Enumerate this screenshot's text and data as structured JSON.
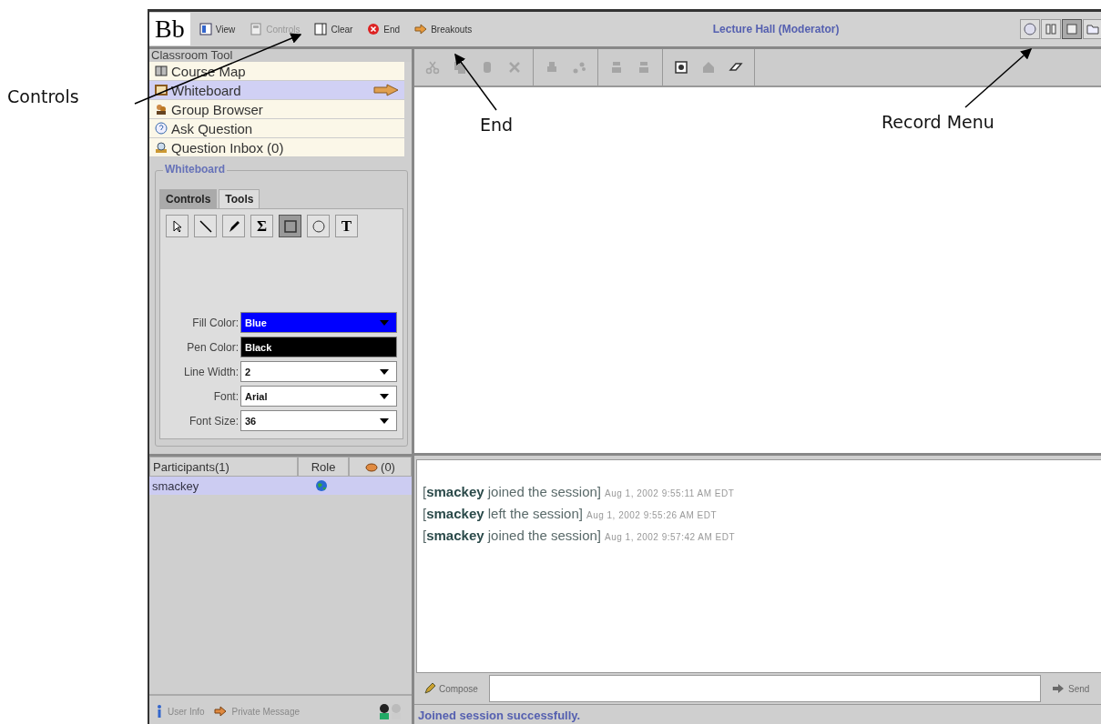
{
  "callouts": [
    {
      "text": "Controls"
    },
    {
      "text": "End"
    },
    {
      "text": "Record Menu"
    }
  ],
  "toolbar": {
    "logo": "Bb",
    "buttons": [
      {
        "label": "View",
        "kind": "view",
        "disabled": false
      },
      {
        "label": "Controls",
        "kind": "controls",
        "disabled": true
      },
      {
        "label": "Clear",
        "kind": "clear",
        "disabled": false
      },
      {
        "label": "End",
        "kind": "end",
        "disabled": false
      },
      {
        "label": "Breakouts",
        "kind": "breakouts",
        "disabled": false
      }
    ],
    "title": "Lecture Hall (Moderator)",
    "record_buttons": [
      {
        "kind": "record",
        "selected": false
      },
      {
        "kind": "pause",
        "selected": false
      },
      {
        "kind": "stop",
        "selected": true
      },
      {
        "kind": "folder",
        "selected": false
      }
    ]
  },
  "classroom": {
    "title": "Classroom Tool",
    "items": [
      {
        "label": "Course Map",
        "kind": "map",
        "selected": false
      },
      {
        "label": "Whiteboard",
        "kind": "whiteboard",
        "selected": true
      },
      {
        "label": "Group Browser",
        "kind": "group",
        "selected": false
      },
      {
        "label": "Ask Question",
        "kind": "question",
        "selected": false
      },
      {
        "label": "Question Inbox (0)",
        "kind": "inbox",
        "selected": false
      }
    ]
  },
  "whiteboard_panel": {
    "title": "Whiteboard",
    "tabs": [
      {
        "label": "Controls",
        "selected": false
      },
      {
        "label": "Tools",
        "selected": true
      }
    ],
    "tools": [
      {
        "kind": "pointer",
        "selected": false
      },
      {
        "kind": "line",
        "selected": false
      },
      {
        "kind": "pen",
        "selected": false
      },
      {
        "kind": "glyph",
        "label": "Σ",
        "selected": false
      },
      {
        "kind": "rectangle",
        "selected": true
      },
      {
        "kind": "ellipse",
        "selected": false
      },
      {
        "kind": "glyph",
        "label": "T",
        "selected": false
      }
    ],
    "fields": [
      {
        "label": "Fill Color:",
        "value": "Blue",
        "kind": "dropdown",
        "color": "#0000ff"
      },
      {
        "label": "Pen Color:",
        "value": "Black",
        "kind": "swatch",
        "color": "#000000"
      },
      {
        "label": "Line Width:",
        "value": "2",
        "kind": "dropdown",
        "color": "#ffffff"
      },
      {
        "label": "Font:",
        "value": "Arial",
        "kind": "dropdown",
        "color": "#ffffff"
      },
      {
        "label": "Font Size:",
        "value": "36",
        "kind": "dropdown",
        "color": "#ffffff"
      }
    ]
  },
  "whiteboard_toolbar": {
    "groups": [
      [
        {
          "kind": "scissors",
          "disabled": true
        },
        {
          "kind": "copy",
          "disabled": true
        },
        {
          "kind": "paste",
          "disabled": true
        },
        {
          "kind": "delete",
          "disabled": true
        }
      ],
      [
        {
          "kind": "print",
          "disabled": true
        },
        {
          "kind": "link",
          "disabled": true
        }
      ],
      [
        {
          "kind": "stack",
          "disabled": true
        },
        {
          "kind": "stack",
          "disabled": true
        }
      ],
      [
        {
          "kind": "frame",
          "disabled": false
        },
        {
          "kind": "house",
          "disabled": true
        },
        {
          "kind": "eraser",
          "disabled": false
        }
      ]
    ]
  },
  "participants": {
    "columns": [
      {
        "label": "Participants(1)"
      },
      {
        "label": "Role"
      },
      {
        "label": "(0)"
      }
    ],
    "rows": [
      {
        "name": "smackey",
        "selected": true
      }
    ],
    "footer": [
      {
        "label": "User Info",
        "kind": "info"
      },
      {
        "label": "Private Message",
        "kind": "message"
      }
    ]
  },
  "chat": {
    "messages": [
      {
        "text": "[**smackey** joined the session]",
        "time": "Aug 1, 2002 9:55:11 AM EDT"
      },
      {
        "text": "[**smackey** left the session]",
        "time": "Aug 1, 2002 9:55:26 AM EDT"
      },
      {
        "text": "[**smackey** joined the session]",
        "time": "Aug 1, 2002 9:57:42 AM EDT"
      }
    ],
    "compose": "Compose",
    "send": {
      "label": "Send",
      "disabled": true
    }
  },
  "status_bar": "Joined session successfully."
}
